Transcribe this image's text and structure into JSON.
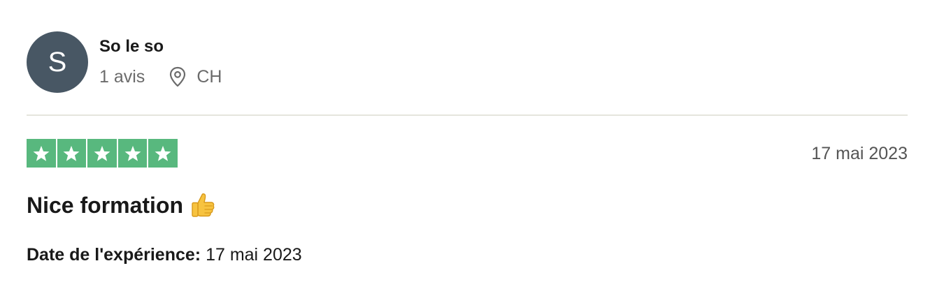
{
  "consumer": {
    "avatar_initial": "S",
    "avatar_color": "#485764",
    "name": "So le so",
    "review_count": "1 avis",
    "location_icon": "location-pin-icon",
    "country": "CH"
  },
  "review": {
    "rating": 5,
    "rating_max": 5,
    "star_color": "#58b87e",
    "date": "17 mai 2023",
    "title": "Nice formation",
    "title_emoji": "thumbs-up-icon",
    "experience_label": "Date de l'expérience:",
    "experience_date": "17 mai 2023"
  }
}
